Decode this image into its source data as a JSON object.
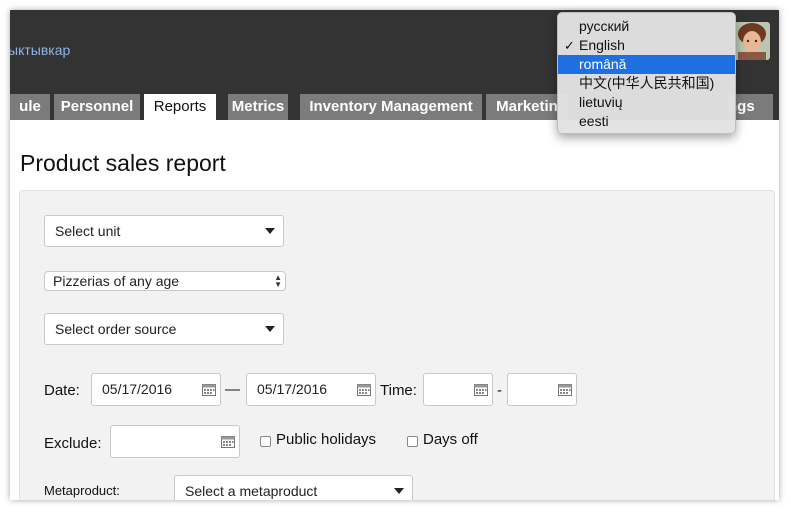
{
  "header": {
    "city": "ыктывкар"
  },
  "tabs": [
    {
      "label": "ule"
    },
    {
      "label": "Personnel"
    },
    {
      "label": "Reports",
      "active": true
    },
    {
      "label": "Metrics"
    },
    {
      "label": "Inventory Management"
    },
    {
      "label": "Marketin"
    },
    {
      "label": "ngs"
    }
  ],
  "page": {
    "title": "Product sales report"
  },
  "form": {
    "unit_select": "Select unit",
    "pizzeria_age_select": "Pizzerias of any age",
    "order_source_select": "Select order source",
    "date_label": "Date:",
    "date_from": "05/17/2016",
    "date_separator": "—",
    "date_to": "05/17/2016",
    "time_label": "Time:",
    "time_separator": "-",
    "time_from": "",
    "time_to": "",
    "exclude_label": "Exclude:",
    "exclude_value": "",
    "public_holidays_label": "Public holidays",
    "days_off_label": "Days off",
    "metaproduct_label": "Metaproduct:",
    "metaproduct_select": "Select a metaproduct"
  },
  "language_menu": {
    "items": [
      {
        "label": "русский",
        "checked": false,
        "highlighted": false
      },
      {
        "label": "English",
        "checked": true,
        "highlighted": false
      },
      {
        "label": "română",
        "checked": false,
        "highlighted": true
      },
      {
        "label": "中文(中华人民共和国)",
        "checked": false,
        "highlighted": false
      },
      {
        "label": "lietuvių",
        "checked": false,
        "highlighted": false
      },
      {
        "label": "eesti",
        "checked": false,
        "highlighted": false
      }
    ],
    "check_mark": "✓"
  },
  "colors": {
    "topbar": "#333333",
    "tab": "#7b7b7b",
    "accent_link": "#8fb4e6",
    "menu_highlight": "#1e6fe0"
  }
}
